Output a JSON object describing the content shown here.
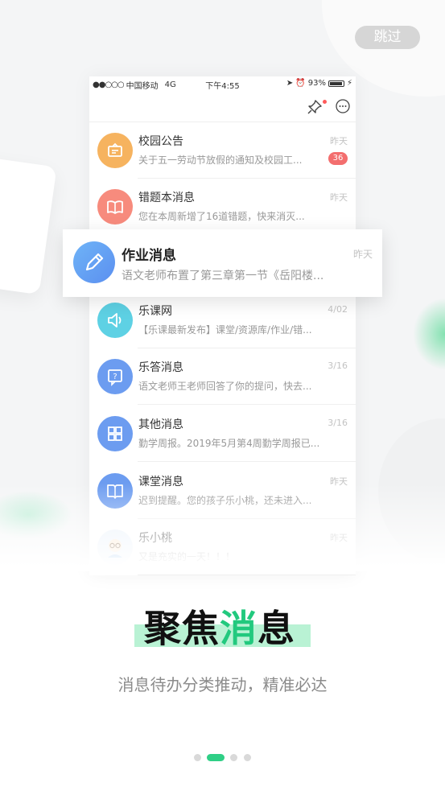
{
  "skip_label": "跳过",
  "status_bar": {
    "carrier": "中国移动",
    "network": "4G",
    "time": "下午4:55",
    "battery": "93%"
  },
  "messages": [
    {
      "title": "校园公告",
      "preview": "关于五一劳动节放假的通知及校园工...",
      "time": "昨天",
      "badge": "36",
      "icon": "announcement-icon",
      "color": "#f6b35f"
    },
    {
      "title": "错题本消息",
      "preview": "您在本周新增了16道错题，快来消灭...",
      "time": "昨天",
      "icon": "book-icon",
      "color": "#f78b7d"
    },
    {
      "title": "乐课网",
      "preview": "【乐课最新发布】课堂/资源库/作业/错...",
      "time": "4/02",
      "icon": "speaker-icon",
      "color": "#5ed1e4"
    },
    {
      "title": "乐答消息",
      "preview": "语文老师王老师回答了你的提问，快去...",
      "time": "3/16",
      "icon": "question-icon",
      "color": "#6c9cf0"
    },
    {
      "title": "其他消息",
      "preview": "勤学周报。2019年5月第4周勤学周报已...",
      "time": "3/16",
      "icon": "grid-icon",
      "color": "#6c9cf0"
    },
    {
      "title": "课堂消息",
      "preview": "迟到提醒。您的孩子乐小桃，还未进入...",
      "time": "昨天",
      "icon": "open-book-icon",
      "color": "#6c9cf0"
    },
    {
      "title": "乐小桃",
      "preview": "又是充实的一天！！！",
      "time": "昨天",
      "icon": "child-avatar-icon",
      "color": "#f5c79a"
    }
  ],
  "featured": {
    "title": "作业消息",
    "preview": "语文老师布置了第三章第一节《岳阳楼...",
    "time": "昨天",
    "icon": "pencil-icon",
    "color": "#5b8ff0"
  },
  "headline": {
    "part1": "聚焦",
    "accent": "消",
    "part2": "息"
  },
  "subtitle": "消息待办分类推动，精准必达",
  "pager": {
    "count": 4,
    "active": 1
  },
  "colors": {
    "accent": "#2fcf86",
    "badge": "#f36e6e"
  }
}
